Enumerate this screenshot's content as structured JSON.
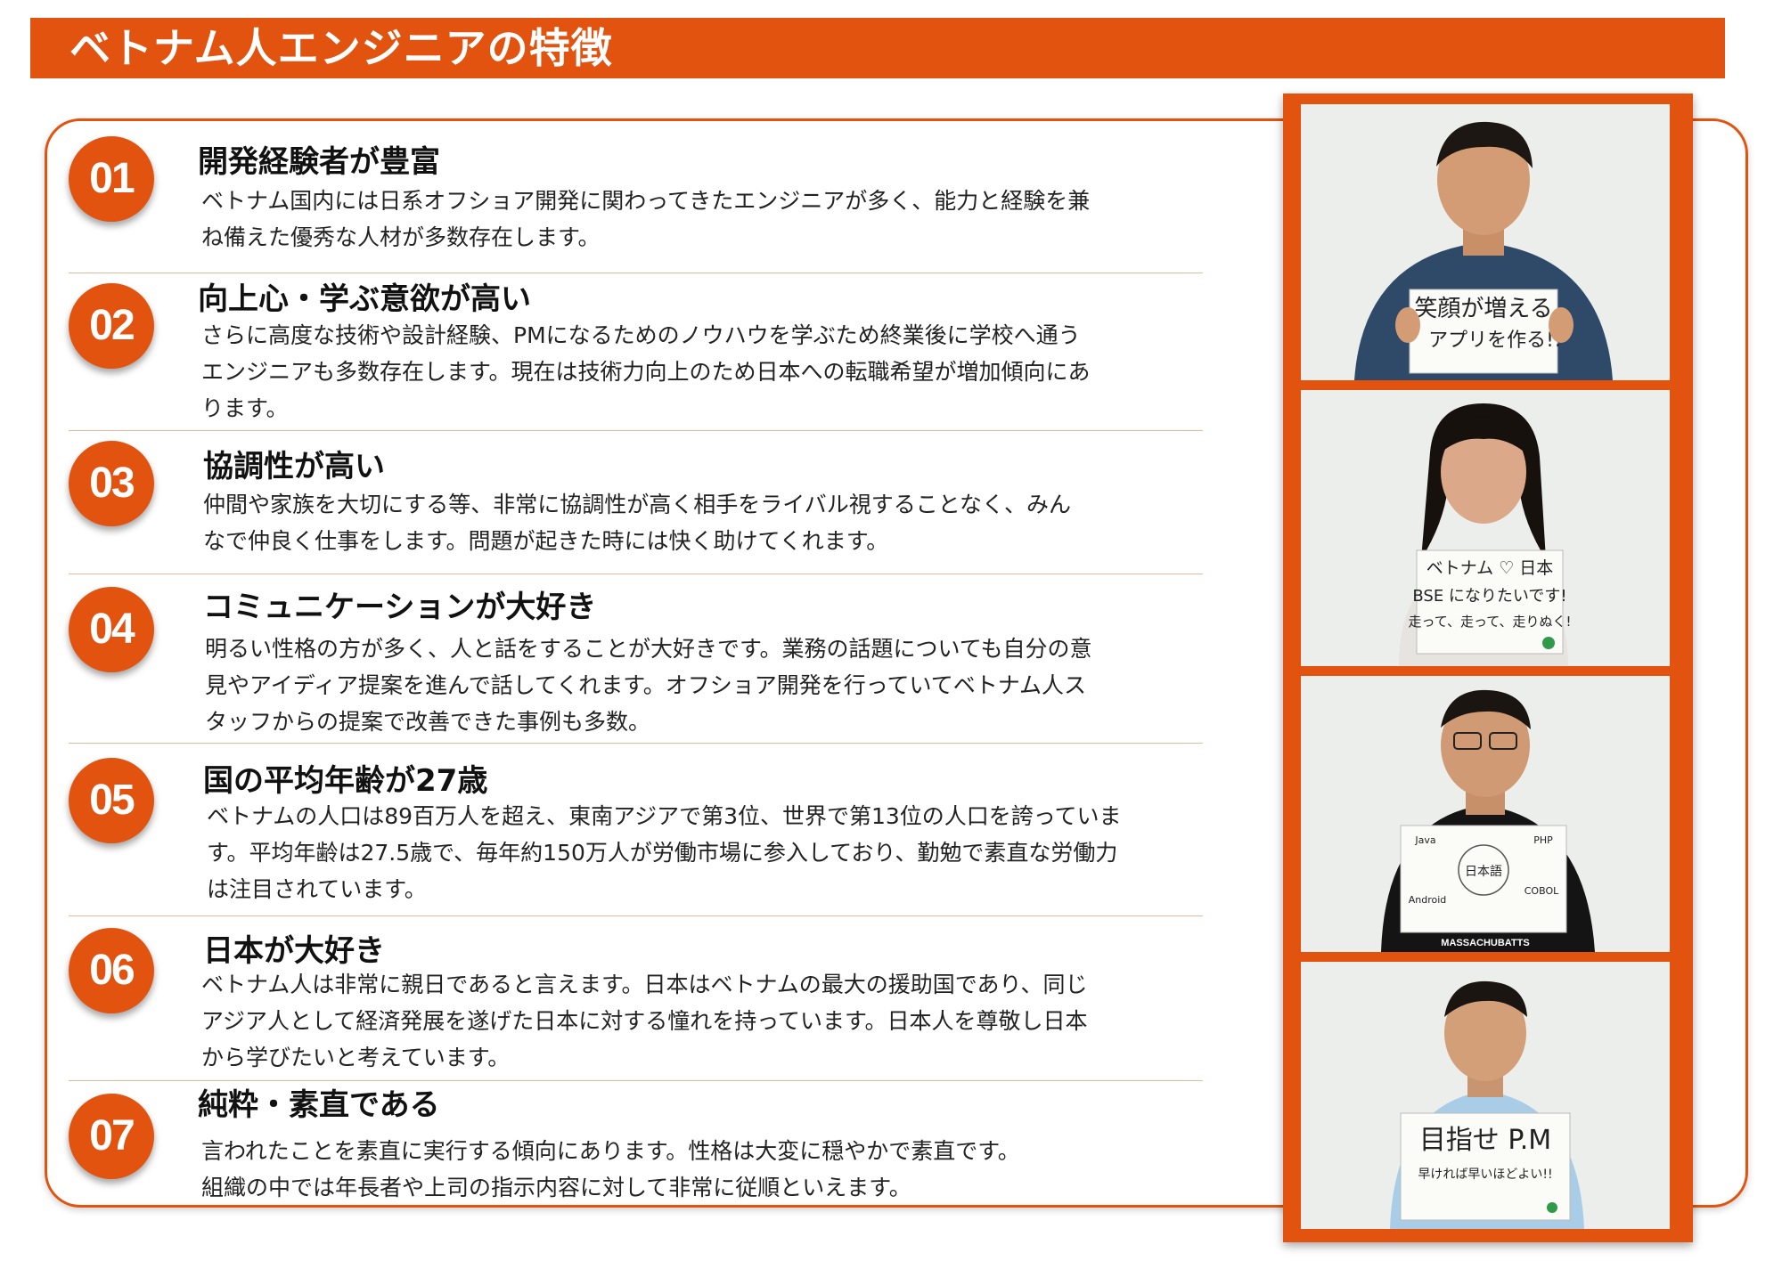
{
  "title": "ベトナム人エンジニアの特徴",
  "items": [
    {
      "number": "01",
      "heading": "開発経験者が豊富",
      "lines": [
        "ベトナム国内には日系オフショア開発に関わってきたエンジニアが多く、能力と経験を兼",
        "ね備えた優秀な人材が多数存在します。"
      ]
    },
    {
      "number": "02",
      "heading": "向上心・学ぶ意欲が高い",
      "lines": [
        "さらに高度な技術や設計経験、PMになるためのノウハウを学ぶため終業後に学校へ通う",
        "エンジニアも多数存在します。現在は技術力向上のため日本への転職希望が増加傾向にあ",
        "ります。"
      ]
    },
    {
      "number": "03",
      "heading": "協調性が高い",
      "lines": [
        "仲間や家族を大切にする等、非常に協調性が高く相手をライバル視することなく、みん",
        "なで仲良く仕事をします。問題が起きた時には快く助けてくれます。"
      ]
    },
    {
      "number": "04",
      "heading": "コミュニケーションが大好き",
      "lines": [
        "明るい性格の方が多く、人と話をすることが大好きです。業務の話題についても自分の意",
        "見やアイディア提案を進んで話してくれます。オフショア開発を行っていてベトナム人ス",
        "タッフからの提案で改善できた事例も多数。"
      ]
    },
    {
      "number": "05",
      "heading": "国の平均年齢が27歳",
      "lines": [
        "ベトナムの人口は89百万人を超え、東南アジアで第3位、世界で第13位の人口を誇っていま",
        "す。平均年齢は27.5歳で、毎年約150万人が労働市場に参入しており、勤勉で素直な労働力",
        "は注目されています。"
      ]
    },
    {
      "number": "06",
      "heading": "日本が大好き",
      "lines": [
        "ベトナム人は非常に親日であると言えます。日本はベトナムの最大の援助国であり、同じ",
        "アジア人として経済発展を遂げた日本に対する憧れを持っています。日本人を尊敬し日本",
        "から学びたいと考えています。"
      ]
    },
    {
      "number": "07",
      "heading": "純粋・素直である",
      "lines": [
        "言われたことを素直に実行する傾向にあります。性格は大変に穏やかで素直です。",
        "組織の中では年長者や上司の指示内容に対して非常に従順といえます。"
      ]
    }
  ],
  "photos": [
    {
      "sign_lines": [
        "笑顔が増える",
        "アプリを作る!!"
      ]
    },
    {
      "sign_lines": [
        "ベトナム ♡ 日本",
        "BSE になりたいです!",
        "走って、走って、走りぬく!"
      ]
    },
    {
      "sign_lines": [
        "日本語",
        "Java",
        "PHP",
        "Android",
        "COBOL"
      ],
      "shirt_text": "MASSACHUBATTS"
    },
    {
      "sign_lines": [
        "目指せ P.M",
        "早ければ早いほどよい!!"
      ]
    }
  ],
  "colors": {
    "accent": "#e25310",
    "divider": "#e9b89a"
  }
}
